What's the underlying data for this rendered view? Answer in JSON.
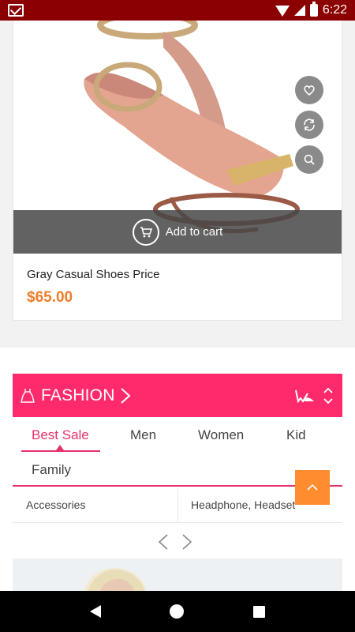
{
  "status_bar": {
    "time": "6:22"
  },
  "product": {
    "name": "Gray Casual Shoes Price",
    "price": "$65.00",
    "add_to_cart_label": "Add to cart",
    "actions": [
      "heart-icon",
      "refresh-icon",
      "search-icon"
    ]
  },
  "fashion": {
    "title": "FASHION",
    "tabs": [
      "Best Sale",
      "Men",
      "Women",
      "Kid",
      "Family"
    ],
    "active_tab": "Best Sale",
    "subcategories": [
      "Accessories",
      "Headphone, Headset"
    ]
  },
  "colors": {
    "accent": "#ff2a6b",
    "price": "#f07c28",
    "scroll_top": "#ff8c2e",
    "status_bar": "#8b0000"
  }
}
